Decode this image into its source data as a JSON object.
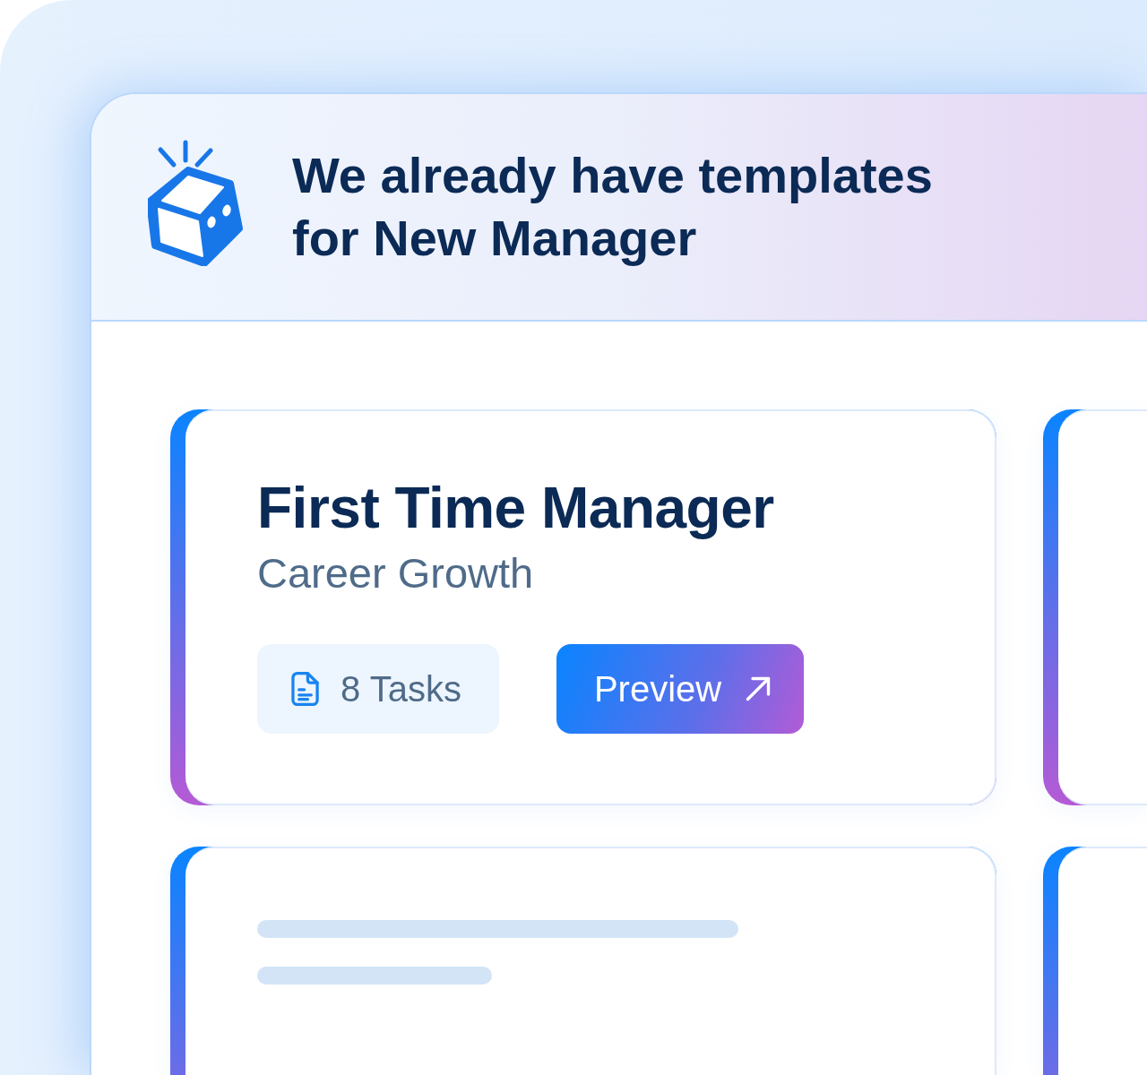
{
  "header": {
    "title": "We already have templates for New Manager"
  },
  "cards": [
    {
      "kind": "template",
      "title": "First Time Manager",
      "subtitle": "Career Growth",
      "tasks": "8 Tasks",
      "button": "Preview"
    },
    {
      "kind": "blank"
    },
    {
      "kind": "skeleton"
    },
    {
      "kind": "blank"
    }
  ]
}
